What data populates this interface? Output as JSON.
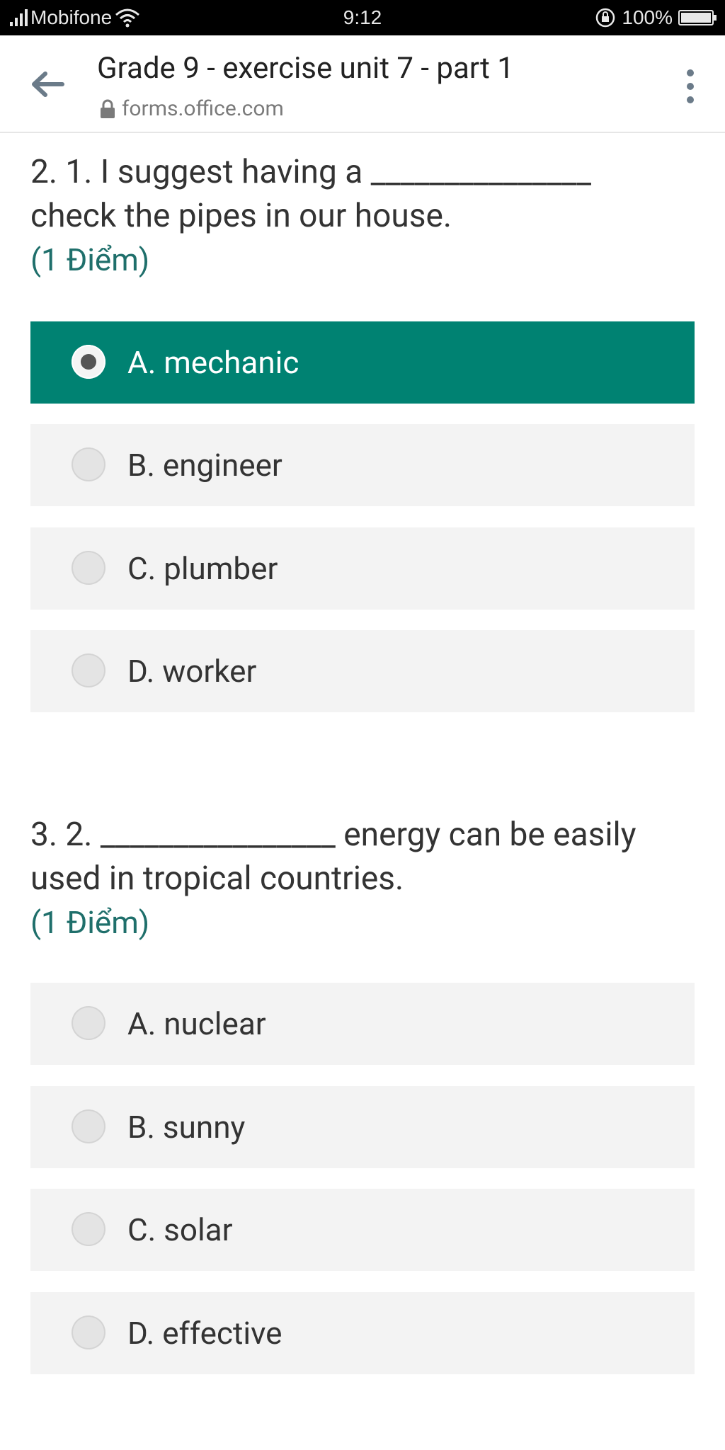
{
  "status_bar": {
    "carrier": "Mobifone",
    "time": "9:12",
    "battery": "100%",
    "battery_level": 1.0
  },
  "toolbar": {
    "title": "Grade 9 - exercise unit 7 - part 1",
    "url": "forms.office.com",
    "icons": [
      "back-arrow-icon",
      "lock-icon",
      "more-vert-icon"
    ]
  },
  "questions": [
    {
      "number": "2. 1.",
      "text_before": "I suggest having a _______________",
      "text_after": "check the pipes in our house.",
      "points": "(1 Điểm)",
      "options": [
        {
          "label": "A. mechanic",
          "selected": true
        },
        {
          "label": "B. engineer",
          "selected": false
        },
        {
          "label": "C. plumber",
          "selected": false
        },
        {
          "label": "D. worker",
          "selected": false
        }
      ]
    },
    {
      "number": "3. 2.",
      "text_before": "________________ energy can be easily",
      "text_after": "used in tropical countries.",
      "points": "(1 Điểm)",
      "options": [
        {
          "label": "A. nuclear",
          "selected": false
        },
        {
          "label": "B. sunny",
          "selected": false
        },
        {
          "label": "C. solar",
          "selected": false
        },
        {
          "label": "D. effective",
          "selected": false
        }
      ]
    }
  ],
  "colors": {
    "accent": "#008272",
    "points": "#1f6f6b",
    "option_bg": "#f3f3f3"
  }
}
